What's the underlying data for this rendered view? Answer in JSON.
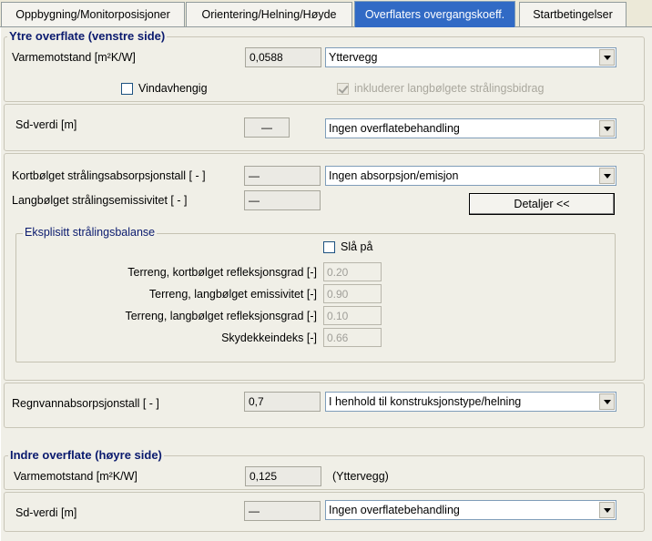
{
  "tabs": [
    {
      "label": "Oppbygning/Monitorposisjoner"
    },
    {
      "label": "Orientering/Helning/Høyde"
    },
    {
      "label": "Overflaters overgangskoeff."
    },
    {
      "label": "Startbetingelser"
    }
  ],
  "outer": {
    "title": "Ytre overflate (venstre side)",
    "resistance_label": "Varmemotstand [m²K/W]",
    "resistance_value": "0,0588",
    "resistance_type": "Yttervegg",
    "wind_dependent_label": "Vindavhengig",
    "wind_dependent_checked": false,
    "include_longwave_label": "inkluderer langbølgete strålingsbidrag",
    "include_longwave_checked": true,
    "sd_label": "Sd-verdi  [m]",
    "sd_value": "—",
    "sd_type": "Ingen overflatebehandling",
    "shortwave_label": "Kortbølget strålingsabsorpsjonstall [ - ]",
    "shortwave_value": "—",
    "shortwave_type": "Ingen absorpsjon/emisjon",
    "longwave_label": "Langbølget strålingsemissivitet [ - ]",
    "longwave_value": "—",
    "details_button": "Detaljer <<",
    "explicit": {
      "title": "Eksplisitt strålingsbalanse",
      "enable_label": "Slå på",
      "enable_checked": false,
      "terrain_short_label": "Terreng, kortbølget refleksjonsgrad [-]",
      "terrain_short_value": "0.20",
      "terrain_emiss_label": "Terreng, langbølget emissivitet [-]",
      "terrain_emiss_value": "0.90",
      "terrain_long_label": "Terreng, langbølget refleksjonsgrad [-]",
      "terrain_long_value": "0.10",
      "cloud_label": "Skydekkeindeks [-]",
      "cloud_value": "0.66"
    },
    "rain_label": "Regnvannabsorpsjonstall [ - ]",
    "rain_value": "0,7",
    "rain_type": "I henhold til konstruksjonstype/helning"
  },
  "inner": {
    "title": "Indre overflate (høyre side)",
    "resistance_label": "Varmemotstand [m²K/W]",
    "resistance_value": "0,125",
    "resistance_type": "(Yttervegg)",
    "sd_label": "Sd-verdi  [m]",
    "sd_value": "—",
    "sd_type": "Ingen overflatebehandling"
  }
}
